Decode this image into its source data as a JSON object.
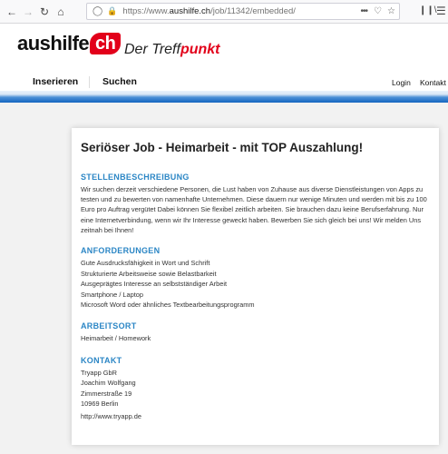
{
  "browser": {
    "url_prefix": "https://www.",
    "url_domain": "aushilfe.ch",
    "url_path": "/job/11342/embedded/",
    "dots": "•••"
  },
  "header": {
    "logo_text": "aushilfe",
    "logo_badge": "ch",
    "tagline_part1": "Der Treff",
    "tagline_part2": "punkt"
  },
  "nav": {
    "insert": "Inserieren",
    "search": "Suchen",
    "login": "Login",
    "contact": "Kontakt"
  },
  "job": {
    "title": "Seriöser Job - Heimarbeit - mit TOP Auszahlung!",
    "description_heading": "STELLENBESCHREIBUNG",
    "description": "Wir suchen derzeit verschiedene Personen, die Lust haben von Zuhause aus diverse Dienstleistungen von Apps zu testen und zu bewerten von namenhafte Unternehmen. Diese dauern nur wenige Minuten und werden mit bis zu 100 Euro pro Auftrag vergütet  Dabei können Sie flexibel zeitlich arbeiten. Sie brauchen dazu keine Berufserfahrung. Nur eine Internetverbindung, wenn wir Ihr Interesse geweckt haben. Bewerben Sie sich gleich bei uns! Wir melden Uns zeitnah bei Ihnen!",
    "requirements_heading": "ANFORDERUNGEN",
    "requirements": [
      "Gute Ausdrucksfähigkeit in Wort und Schrift",
      "Strukturierte Arbeitsweise sowie Belastbarkeit",
      "Ausgeprägtes Interesse an selbstständiger Arbeit",
      "Smartphone / Laptop",
      "Microsoft Word oder ähnliches Textbearbeitungsprogramm"
    ],
    "location_heading": "ARBEITSORT",
    "location": "Heimarbeit / Homework",
    "contact_heading": "KONTAKT",
    "contact_lines": [
      "Tryapp GbR",
      "Joachim Wolfgang",
      "Zimmerstraße 19",
      "10969 Berlin"
    ],
    "contact_link": "http://www.tryapp.de"
  }
}
